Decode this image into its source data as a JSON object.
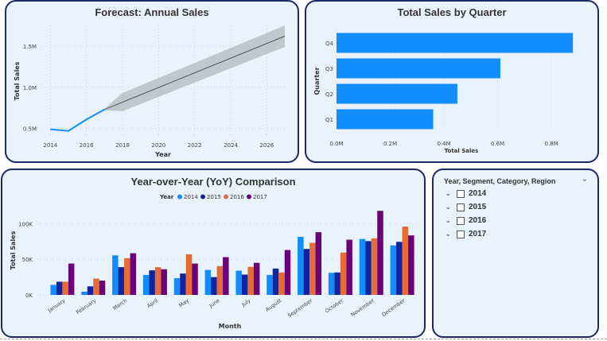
{
  "forecast": {
    "title": "Forecast: Annual Sales",
    "chart_data": {
      "type": "line",
      "title": "Forecast: Annual Sales",
      "xlabel": "Year",
      "ylabel": "Total Sales",
      "xlim": [
        2013.5,
        2027
      ],
      "ylim": [
        0.4,
        1.75
      ],
      "x_ticks": [
        2014,
        2016,
        2018,
        2020,
        2022,
        2024,
        2026
      ],
      "y_ticks": [
        {
          "value": 0.5,
          "label": "0.5M"
        },
        {
          "value": 1.0,
          "label": "1.0M"
        },
        {
          "value": 1.5,
          "label": "1.5M"
        }
      ],
      "actual": {
        "x": [
          2014,
          2015,
          2016,
          2017
        ],
        "y": [
          0.49,
          0.47,
          0.61,
          0.73
        ]
      },
      "forecast": {
        "x": [
          2017,
          2027
        ],
        "y": [
          0.73,
          1.62
        ]
      },
      "band_upper": {
        "x": [
          2017,
          2018,
          2027
        ],
        "y": [
          0.74,
          0.93,
          1.75
        ]
      },
      "band_lower": {
        "x": [
          2017,
          2018,
          2027
        ],
        "y": [
          0.72,
          0.71,
          1.49
        ]
      },
      "colors": {
        "actual": "#118dff",
        "forecast": "#555555",
        "band": "#b9bec4"
      }
    }
  },
  "quarter": {
    "title": "Total Sales by Quarter",
    "chart_data": {
      "type": "bar",
      "orientation": "horizontal",
      "title": "Total Sales by Quarter",
      "categories": [
        "Q4",
        "Q3",
        "Q2",
        "Q1"
      ],
      "values": [
        0.88,
        0.61,
        0.45,
        0.36
      ],
      "xlabel": "Total Sales",
      "ylabel": "Quarter",
      "xlim": [
        0,
        0.93
      ],
      "x_ticks": [
        {
          "value": 0,
          "label": "0.0M"
        },
        {
          "value": 0.2,
          "label": "0.2M"
        },
        {
          "value": 0.4,
          "label": "0.4M"
        },
        {
          "value": 0.6,
          "label": "0.6M"
        },
        {
          "value": 0.8,
          "label": "0.8M"
        }
      ],
      "color": "#118dff"
    }
  },
  "yoy": {
    "title": "Year-over-Year (YoY) Comparison",
    "legend_title": "Year",
    "chart_data": {
      "type": "bar",
      "title": "Year-over-Year (YoY) Comparison",
      "xlabel": "Month",
      "ylabel": "Total Sales",
      "ylim": [
        0,
        125
      ],
      "y_ticks": [
        {
          "value": 0,
          "label": "0K"
        },
        {
          "value": 50,
          "label": "50K"
        },
        {
          "value": 100,
          "label": "100K"
        }
      ],
      "categories": [
        "January",
        "February",
        "March",
        "April",
        "May",
        "June",
        "July",
        "August",
        "September",
        "October",
        "November",
        "December"
      ],
      "series": [
        {
          "name": "2014",
          "color": "#118dff",
          "values": [
            14,
            4.5,
            55.5,
            28,
            23.5,
            35,
            34,
            28,
            81.5,
            31,
            78.5,
            69.5
          ]
        },
        {
          "name": "2015",
          "color": "#12239e",
          "values": [
            18.5,
            12,
            39,
            34.5,
            30,
            25,
            28.5,
            37,
            64.5,
            31.5,
            75.5,
            74.5
          ]
        },
        {
          "name": "2016",
          "color": "#e66c37",
          "values": [
            18.5,
            23,
            51.5,
            39,
            57,
            40.5,
            39.5,
            31.5,
            73,
            59.5,
            79.5,
            96
          ]
        },
        {
          "name": "2017",
          "color": "#6b007b",
          "values": [
            44,
            20,
            58.5,
            36,
            44,
            53,
            45,
            63,
            88,
            77.5,
            118,
            83.5
          ]
        }
      ]
    }
  },
  "slicer": {
    "title": "Year, Segment, Category, Region",
    "items": [
      "2014",
      "2015",
      "2016",
      "2017"
    ]
  }
}
